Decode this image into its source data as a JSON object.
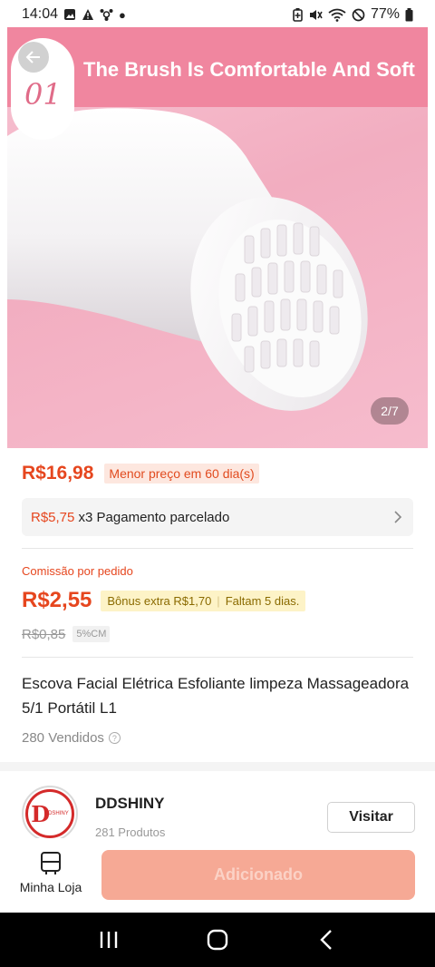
{
  "status_bar": {
    "time": "14:04",
    "battery": "77%",
    "left_icons": [
      "gallery-icon",
      "alert-icon",
      "share-icon",
      "dot-icon"
    ],
    "right_icons": [
      "battery-saver-icon",
      "mute-icon",
      "wifi-icon",
      "do-not-disturb-icon",
      "battery-icon"
    ]
  },
  "hero": {
    "banner_title": "The Brush Is Comfortable And Soft",
    "badge_number": "01",
    "image_pager": "2/7",
    "colors": {
      "band": "#f0869f",
      "background": "#f5b7c8"
    }
  },
  "pricing": {
    "price": "R$16,98",
    "lowest_price_tag": "Menor preço em 60 dia(s)",
    "installment_value": "R$5,75",
    "installment_text": "x3 Pagamento parcelado"
  },
  "commission": {
    "label": "Comissão por pedido",
    "value": "R$2,55",
    "bonus_text": "Bônus extra R$1,70",
    "bonus_days": "Faltam 5 dias.",
    "old_value": "R$0,85",
    "cm_tag": "5%CM"
  },
  "product": {
    "title": "Escova Facial Elétrica Esfoliante limpeza Massageadora 5/1 Portátil L1",
    "sold": "280 Vendidos"
  },
  "shop": {
    "name": "DDSHINY",
    "products": "281 Produtos",
    "visit_label": "Visitar",
    "logo_letter": "D",
    "logo_text": "DSHINY"
  },
  "action_bar": {
    "store_label": "Minha Loja",
    "add_label": "Adicionado"
  },
  "colors": {
    "accent": "#e6461e",
    "add_button": "#f6a995"
  }
}
